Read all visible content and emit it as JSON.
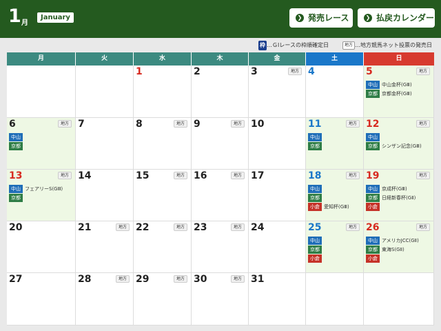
{
  "header": {
    "month_num": "1",
    "month_kanji": "月",
    "month_en": "January",
    "btn_sale": "発売レース",
    "btn_refund": "払戻カレンダー"
  },
  "legend": {
    "waku_icon": "枠",
    "waku_text": "…ＧⅠレースの枠順確定日",
    "chiho_icon": "地方",
    "chiho_text": "…地方競馬ネット投票の発売日"
  },
  "colors": {
    "header_green": "#245a1f",
    "weekday_header": "#3c8a80",
    "saturday_blue": "#1a77c9",
    "sunday_red": "#d73a2f",
    "nakayama": "#1f6eb8",
    "kyoto": "#2e7d46",
    "kokura": "#c53228",
    "race_day_bg": "#eef8e4"
  },
  "weekdays": [
    "月",
    "火",
    "水",
    "木",
    "金",
    "土",
    "日"
  ],
  "weeks": [
    [
      {
        "day": "",
        "chiho": false,
        "events": []
      },
      {
        "day": "",
        "chiho": false,
        "events": []
      },
      {
        "day": "1",
        "color": "red",
        "chiho": false,
        "events": []
      },
      {
        "day": "2",
        "chiho": false,
        "events": []
      },
      {
        "day": "3",
        "chiho": true,
        "events": []
      },
      {
        "day": "4",
        "color": "blue",
        "chiho": false,
        "events": []
      },
      {
        "day": "5",
        "color": "red",
        "chiho": true,
        "green": true,
        "events": [
          {
            "venue": "中山",
            "vc": "nakayama",
            "race": "中山金杯(GⅢ)"
          },
          {
            "venue": "京都",
            "vc": "kyoto",
            "race": "京都金杯(GⅢ)"
          }
        ]
      }
    ],
    [
      {
        "day": "6",
        "chiho": true,
        "green": true,
        "events": [
          {
            "venue": "中山",
            "vc": "nakayama",
            "race": ""
          },
          {
            "venue": "京都",
            "vc": "kyoto",
            "race": ""
          }
        ]
      },
      {
        "day": "7",
        "chiho": false,
        "events": []
      },
      {
        "day": "8",
        "chiho": true,
        "events": []
      },
      {
        "day": "9",
        "chiho": true,
        "events": []
      },
      {
        "day": "10",
        "chiho": false,
        "events": []
      },
      {
        "day": "11",
        "color": "blue",
        "chiho": true,
        "green": true,
        "events": [
          {
            "venue": "中山",
            "vc": "nakayama",
            "race": ""
          },
          {
            "venue": "京都",
            "vc": "kyoto",
            "race": ""
          }
        ]
      },
      {
        "day": "12",
        "color": "red",
        "chiho": true,
        "green": true,
        "events": [
          {
            "venue": "中山",
            "vc": "nakayama",
            "race": ""
          },
          {
            "venue": "京都",
            "vc": "kyoto",
            "race": "シンザン記念(GⅢ)"
          }
        ]
      }
    ],
    [
      {
        "day": "13",
        "color": "red",
        "chiho": true,
        "green": true,
        "events": [
          {
            "venue": "中山",
            "vc": "nakayama",
            "race": "フェアリーS(GⅢ)"
          },
          {
            "venue": "京都",
            "vc": "kyoto",
            "race": ""
          }
        ]
      },
      {
        "day": "14",
        "chiho": false,
        "events": []
      },
      {
        "day": "15",
        "chiho": true,
        "events": []
      },
      {
        "day": "16",
        "chiho": true,
        "events": []
      },
      {
        "day": "17",
        "chiho": false,
        "events": []
      },
      {
        "day": "18",
        "color": "blue",
        "chiho": true,
        "green": true,
        "events": [
          {
            "venue": "中山",
            "vc": "nakayama",
            "race": ""
          },
          {
            "venue": "京都",
            "vc": "kyoto",
            "race": ""
          },
          {
            "venue": "小倉",
            "vc": "kokura",
            "race": "愛知杯(GⅢ)"
          }
        ]
      },
      {
        "day": "19",
        "color": "red",
        "chiho": true,
        "green": true,
        "events": [
          {
            "venue": "中山",
            "vc": "nakayama",
            "race": "京成杯(GⅢ)"
          },
          {
            "venue": "京都",
            "vc": "kyoto",
            "race": "日経新春杯(GⅡ)"
          },
          {
            "venue": "小倉",
            "vc": "kokura",
            "race": ""
          }
        ]
      }
    ],
    [
      {
        "day": "20",
        "chiho": false,
        "events": []
      },
      {
        "day": "21",
        "chiho": true,
        "events": []
      },
      {
        "day": "22",
        "chiho": true,
        "events": []
      },
      {
        "day": "23",
        "chiho": true,
        "events": []
      },
      {
        "day": "24",
        "chiho": false,
        "events": []
      },
      {
        "day": "25",
        "color": "blue",
        "chiho": true,
        "green": true,
        "events": [
          {
            "venue": "中山",
            "vc": "nakayama",
            "race": ""
          },
          {
            "venue": "京都",
            "vc": "kyoto",
            "race": ""
          },
          {
            "venue": "小倉",
            "vc": "kokura",
            "race": ""
          }
        ]
      },
      {
        "day": "26",
        "color": "red",
        "chiho": true,
        "green": true,
        "events": [
          {
            "venue": "中山",
            "vc": "nakayama",
            "race": "アメリカJCC(GⅡ)"
          },
          {
            "venue": "京都",
            "vc": "kyoto",
            "race": "東海S(GⅡ)"
          },
          {
            "venue": "小倉",
            "vc": "kokura",
            "race": ""
          }
        ]
      }
    ],
    [
      {
        "day": "27",
        "chiho": false,
        "events": []
      },
      {
        "day": "28",
        "chiho": true,
        "events": []
      },
      {
        "day": "29",
        "chiho": true,
        "events": []
      },
      {
        "day": "30",
        "chiho": true,
        "events": []
      },
      {
        "day": "31",
        "chiho": false,
        "events": []
      },
      {
        "day": "",
        "chiho": false,
        "events": []
      },
      {
        "day": "",
        "chiho": false,
        "events": []
      }
    ]
  ]
}
